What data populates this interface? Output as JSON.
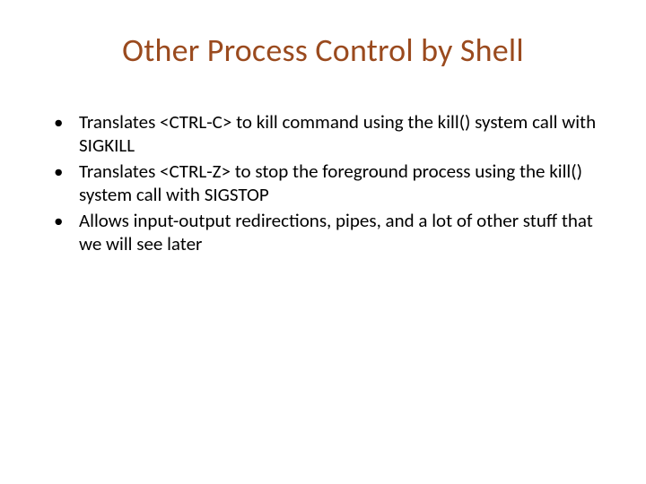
{
  "title": "Other Process Control by Shell",
  "bullets": [
    "Translates <CTRL-C> to kill command using the kill() system call with SIGKILL",
    "Translates <CTRL-Z> to stop the foreground process using the kill() system call with SIGSTOP",
    "Allows input-output redirections, pipes, and a lot of other stuff that we will see later"
  ]
}
